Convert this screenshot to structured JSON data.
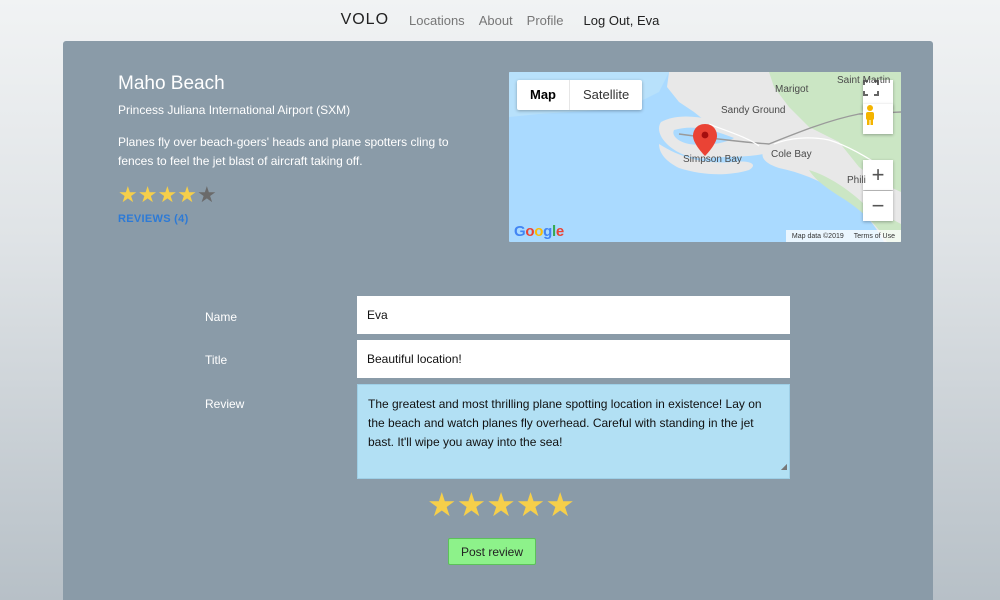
{
  "nav": {
    "brand": "VOLO",
    "links": [
      "Locations",
      "About",
      "Profile"
    ],
    "logout": "Log Out, Eva"
  },
  "location": {
    "title": "Maho Beach",
    "subtitle": "Princess Juliana International Airport (SXM)",
    "description": "Planes fly over beach-goers' heads and plane spotters cling to fences to feel the jet blast of aircraft taking off.",
    "rating": 4,
    "rating_max": 5,
    "reviews_link": "REVIEWS (4)"
  },
  "map": {
    "type_buttons": [
      "Map",
      "Satellite"
    ],
    "active_type": "Map",
    "labels": [
      "Saint Martin",
      "Marigot",
      "Sandy Ground",
      "Simpson Bay",
      "Cole Bay",
      "Phili"
    ],
    "logo": "Google",
    "footer_data": "Map data ©2019",
    "footer_terms": "Terms of Use",
    "zoom_in": "+",
    "zoom_out": "−",
    "colors": {
      "water": "#aadaff",
      "land": "#e8e8e8",
      "green": "#cbe6c4",
      "pin": "#ea4335"
    }
  },
  "form": {
    "name_label": "Name",
    "name_value": "Eva",
    "title_label": "Title",
    "title_value": "Beautiful location!",
    "review_label": "Review",
    "review_value": "The greatest and most thrilling plane spotting location in existence! Lay on the beach and watch planes fly overhead. Careful with standing in the jet bast. It'll wipe you away into the sea!",
    "stars_selected": 5,
    "submit_label": "Post review"
  }
}
